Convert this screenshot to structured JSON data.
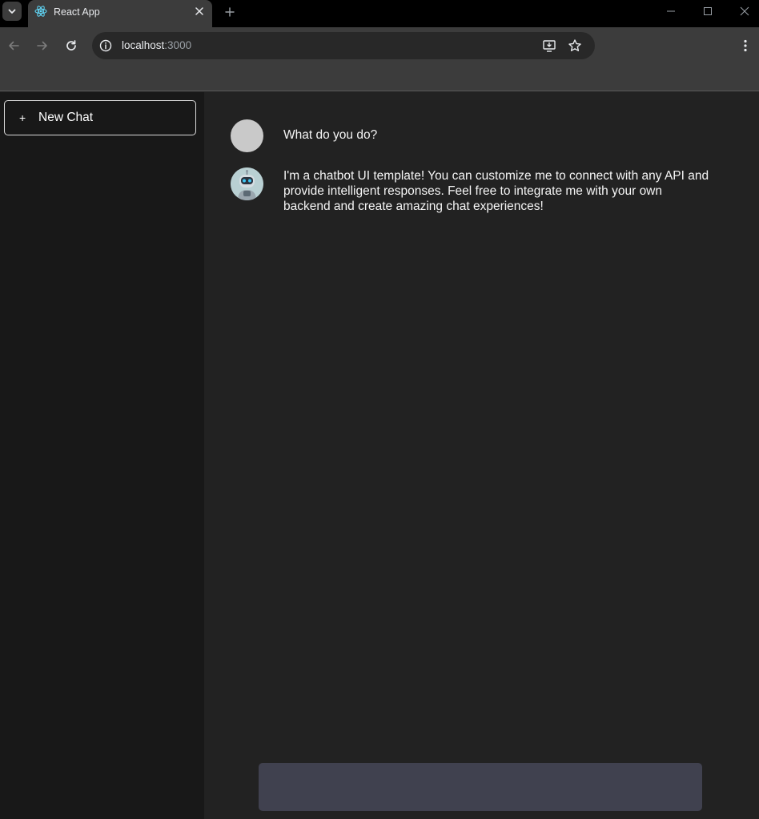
{
  "browser": {
    "tab_title": "React App",
    "url_host": "localhost",
    "url_port": ":3000",
    "icons": [
      "tab-search-icon",
      "react-favicon-icon",
      "close-icon",
      "plus-icon",
      "minimize-icon",
      "maximize-icon",
      "window-close-icon",
      "back-arrow-icon",
      "forward-arrow-icon",
      "reload-icon",
      "info-icon",
      "install-app-icon",
      "bookmark-star-icon",
      "kebab-menu-icon"
    ]
  },
  "sidebar": {
    "new_chat_plus": "+",
    "new_chat_label": "New Chat"
  },
  "chat": {
    "messages": [
      {
        "role": "user",
        "text": "What do you do?"
      },
      {
        "role": "bot",
        "text": "I'm a chatbot UI template! You can customize me to connect with any API and provide intelligent responses. Feel free to integrate me with your own backend and create amazing chat experiences!"
      }
    ],
    "input_value": "",
    "input_placeholder": ""
  },
  "colors": {
    "sidebar_bg": "#181818",
    "main_bg": "#222222",
    "input_bg": "#40414f",
    "chrome_bg": "#3c3c3c",
    "user_avatar": "#c9c9c9"
  }
}
